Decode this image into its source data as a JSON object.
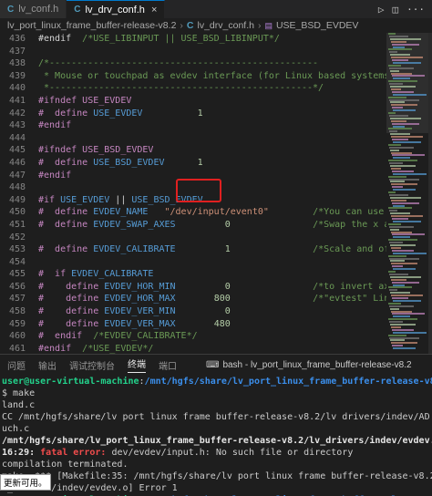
{
  "tabs": [
    {
      "icon": "C",
      "label": "lv_conf.h",
      "active": false
    },
    {
      "icon": "C",
      "label": "lv_drv_conf.h",
      "active": true
    }
  ],
  "breadcrumb": {
    "folder": "lv_port_linux_frame_buffer-release-v8.2",
    "file": "lv_drv_conf.h",
    "symbol": "USE_BSD_EVDEV"
  },
  "editor": {
    "lines": [
      {
        "n": "436",
        "t": [
          [
            "#endif  ",
            ""
          ],
          [
            "/*USE_LIBINPUT || USE_BSD_LIBINPUT*/",
            "cmt"
          ]
        ]
      },
      {
        "n": "437",
        "t": []
      },
      {
        "n": "438",
        "t": [
          [
            "/*-------------------------------------------------",
            "cmt"
          ]
        ]
      },
      {
        "n": "439",
        "t": [
          [
            " * Mouse or touchpad as evdev interface (for Linux based systems)",
            "cmt"
          ]
        ]
      },
      {
        "n": "440",
        "t": [
          [
            " *------------------------------------------------*/",
            "cmt"
          ]
        ]
      },
      {
        "n": "441",
        "t": [
          [
            "#ifndef ",
            "kw"
          ],
          [
            "USE_EVDEV",
            "kw"
          ]
        ]
      },
      {
        "n": "442",
        "t": [
          [
            "#  define ",
            "kw"
          ],
          [
            "USE_EVDEV",
            "mac"
          ],
          [
            "          ",
            ""
          ],
          [
            "1",
            "num"
          ]
        ]
      },
      {
        "n": "443",
        "t": [
          [
            "#endif",
            "kw"
          ]
        ]
      },
      {
        "n": "444",
        "t": []
      },
      {
        "n": "445",
        "t": [
          [
            "#ifndef ",
            "kw"
          ],
          [
            "USE_BSD_EVDEV",
            "kw"
          ]
        ]
      },
      {
        "n": "446",
        "t": [
          [
            "#  define ",
            "kw"
          ],
          [
            "USE_BSD_EVDEV",
            "mac"
          ],
          [
            "      ",
            ""
          ],
          [
            "1",
            "num"
          ]
        ]
      },
      {
        "n": "447",
        "t": [
          [
            "#endif",
            "kw"
          ]
        ]
      },
      {
        "n": "448",
        "t": []
      },
      {
        "n": "449",
        "t": [
          [
            "#if ",
            "kw"
          ],
          [
            "USE_EVDEV",
            "mac"
          ],
          [
            " || ",
            ""
          ],
          [
            "USE_BSD_EVDEV",
            "mac"
          ]
        ]
      },
      {
        "n": "450",
        "t": [
          [
            "#  define ",
            "kw"
          ],
          [
            "EVDEV_NAME",
            "mac"
          ],
          [
            "   ",
            ""
          ],
          [
            "\"/dev/input/event0\"",
            "str"
          ],
          [
            "        ",
            ""
          ],
          [
            "/*You can use the",
            "cmt"
          ]
        ]
      },
      {
        "n": "451",
        "t": [
          [
            "#  define ",
            "kw"
          ],
          [
            "EVDEV_SWAP_AXES",
            "mac"
          ],
          [
            "         ",
            ""
          ],
          [
            "0",
            "num"
          ],
          [
            "               ",
            ""
          ],
          [
            "/*Swap the x and",
            "cmt"
          ]
        ]
      },
      {
        "n": "452",
        "t": []
      },
      {
        "n": "453",
        "t": [
          [
            "#  define ",
            "kw"
          ],
          [
            "EVDEV_CALIBRATE",
            "mac"
          ],
          [
            "         ",
            ""
          ],
          [
            "1",
            "num"
          ],
          [
            "               ",
            ""
          ],
          [
            "/*Scale and offse",
            "cmt"
          ]
        ]
      },
      {
        "n": "454",
        "t": []
      },
      {
        "n": "455",
        "t": [
          [
            "#  if ",
            "kw"
          ],
          [
            "EVDEV_CALIBRATE",
            "mac"
          ]
        ]
      },
      {
        "n": "456",
        "t": [
          [
            "#    define ",
            "kw"
          ],
          [
            "EVDEV_HOR_MIN",
            "mac"
          ],
          [
            "         ",
            ""
          ],
          [
            "0",
            "num"
          ],
          [
            "               ",
            ""
          ],
          [
            "/*to invert axis",
            "cmt"
          ]
        ]
      },
      {
        "n": "457",
        "t": [
          [
            "#    define ",
            "kw"
          ],
          [
            "EVDEV_HOR_MAX",
            "mac"
          ],
          [
            "       ",
            ""
          ],
          [
            "800",
            "num"
          ],
          [
            "               ",
            ""
          ],
          [
            "/*\"evtest\" Linux",
            "cmt"
          ]
        ]
      },
      {
        "n": "458",
        "t": [
          [
            "#    define ",
            "kw"
          ],
          [
            "EVDEV_VER_MIN",
            "mac"
          ],
          [
            "         ",
            ""
          ],
          [
            "0",
            "num"
          ]
        ]
      },
      {
        "n": "459",
        "t": [
          [
            "#    define ",
            "kw"
          ],
          [
            "EVDEV_VER_MAX",
            "mac"
          ],
          [
            "       ",
            ""
          ],
          [
            "480",
            "num"
          ]
        ]
      },
      {
        "n": "460",
        "t": [
          [
            "#  endif  ",
            "kw"
          ],
          [
            "/*EVDEV_CALIBRATE*/",
            "cmt"
          ]
        ]
      },
      {
        "n": "461",
        "t": [
          [
            "#endif  ",
            "kw"
          ],
          [
            "/*USE_EVDEV*/",
            "cmt"
          ]
        ]
      },
      {
        "n": "462",
        "t": []
      },
      {
        "n": "463",
        "t": [
          [
            "/*",
            "cmt"
          ]
        ]
      }
    ]
  },
  "panel": {
    "tabs": [
      "问题",
      "输出",
      "调试控制台",
      "终端",
      "端口"
    ],
    "active_tab": "终端",
    "terminal_label": "bash - lv_port_linux_frame_buffer-release-v8.2",
    "actions": "+ ∨ ⊟ 🗑 ··· ∧ ×",
    "lines": [
      [
        [
          "user@user-virtual-machine",
          "user"
        ],
        [
          ":",
          ""
        ],
        [
          "/mnt/hgfs/share/lv_port_linux_frame_buffer-release-v8.2",
          "path"
        ]
      ],
      [
        [
          "$ make",
          ""
        ]
      ],
      [
        [
          "land.c",
          ""
        ]
      ],
      [
        [
          "CC /mnt/hgfs/share/lv port linux frame buffer-release-v8.2/lv drivers/indev/AD to",
          ""
        ]
      ],
      [
        [
          "uch.c",
          ""
        ]
      ],
      [
        [
          "/mnt/hgfs/share/lv_port_linux_frame_buffer-release-v8.2/lv_drivers/indev/evdev.c:",
          "bold"
        ]
      ],
      [
        [
          "16:29: ",
          "bold"
        ],
        [
          "fatal error: ",
          "err"
        ],
        [
          "dev/evdev/input.h: No such file or directory",
          ""
        ]
      ],
      [
        [
          "compilation terminated.",
          ""
        ]
      ],
      [
        [
          "make: *** [Makefile:35: /mnt/hgfs/share/lv port linux frame buffer-release-v8.2/l",
          ""
        ]
      ],
      [
        [
          "v_drivers/indev/evdev.o] Error 1",
          ""
        ]
      ],
      [
        [
          "user@user-virtual-machine",
          "user"
        ],
        [
          ":",
          ""
        ],
        [
          "/mnt/hgfs/share/lv_port_linux_frame_buffer-release-v8.2",
          "path"
        ]
      ]
    ],
    "tooltip": "更新可用。"
  }
}
